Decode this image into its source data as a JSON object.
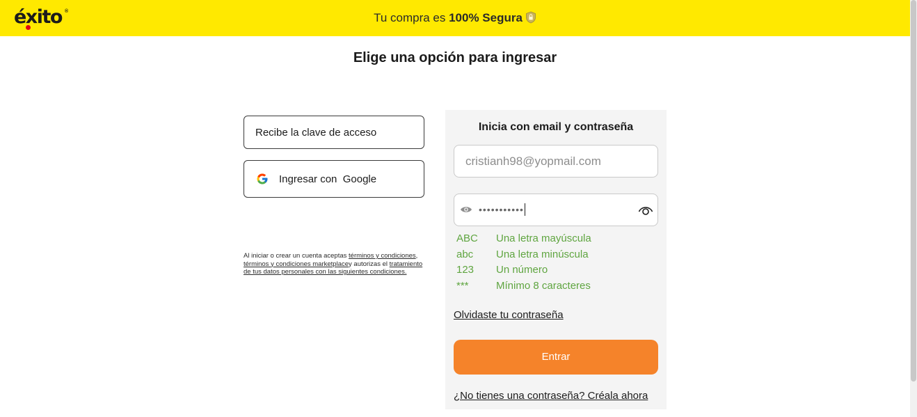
{
  "header": {
    "logo_text": "éxito",
    "logo_registered": "®",
    "secure_prefix": "Tu compra es ",
    "secure_bold": "100% Segura",
    "shield_icon": "shield-lock-icon",
    "bg_color": "#ffe900"
  },
  "page": {
    "title": "Elige una opción para ingresar"
  },
  "options": {
    "access_code_label": "Recibe la clave de acceso",
    "google_label": "Ingresar con  Google",
    "google_icon": "google-icon"
  },
  "legal": {
    "p1": "Al iniciar o crear un cuenta aceptas ",
    "link_terms": "términos y condiciones",
    "p2": ", ",
    "link_marketplace": "términos y condiciones marketplace",
    "p3": "y autorizas el ",
    "link_data": "tratamiento de tus datos personales con las siguientes condiciones."
  },
  "login": {
    "title": "Inicia con email y contraseña",
    "email_value": "cristianh98@yopmail.com",
    "password_mask": "•••••••••••",
    "rules": [
      {
        "code": "ABC",
        "text": "Una letra mayúscula"
      },
      {
        "code": "abc",
        "text": "Una letra minúscula"
      },
      {
        "code": "123",
        "text": "Un número"
      },
      {
        "code": "***",
        "text": "Mínimo 8 caracteres"
      }
    ],
    "rule_color": "#5fa540",
    "forgot_label": "Olvidaste tu contraseña",
    "submit_label": "Entrar",
    "submit_color": "#f5832a",
    "create_label": "¿No tienes una contraseña? Créala ahora"
  }
}
